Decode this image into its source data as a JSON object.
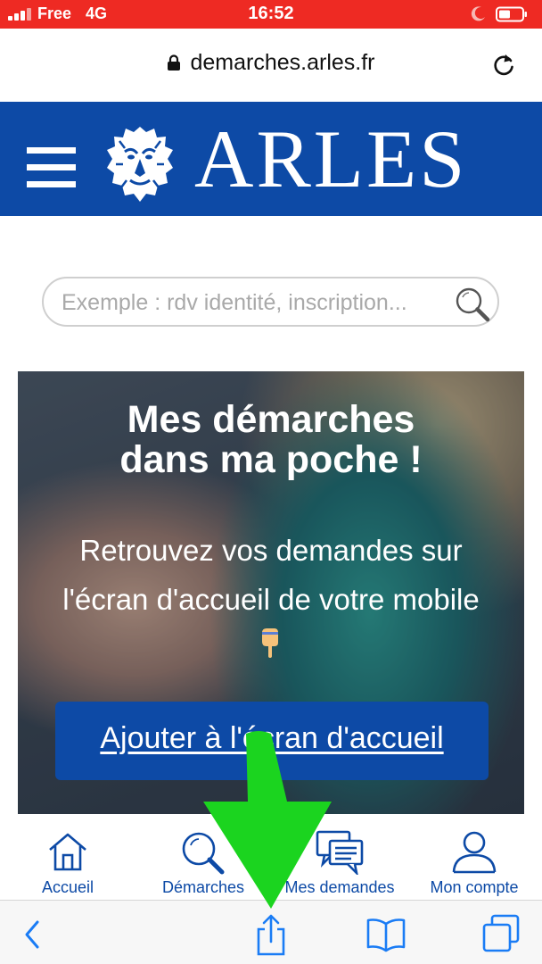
{
  "status_bar": {
    "carrier": "Free",
    "network": "4G",
    "time": "16:52"
  },
  "address_bar": {
    "url": "demarches.arles.fr"
  },
  "site_header": {
    "brand": "ARLES"
  },
  "search": {
    "placeholder": "Exemple : rdv identité, inscription..."
  },
  "promo": {
    "title_line1": "Mes démarches",
    "title_line2": "dans ma poche !",
    "subtitle_line1": "Retrouvez vos demandes sur",
    "subtitle_line2": "l'écran d'accueil de votre mobile",
    "cta_label": "Ajouter à l'écran d'accueil"
  },
  "site_nav": {
    "items": [
      {
        "label": "Accueil",
        "icon": "home-icon"
      },
      {
        "label": "Démarches",
        "icon": "search-icon"
      },
      {
        "label": "Mes demandes",
        "icon": "chat-icon"
      },
      {
        "label": "Mon compte",
        "icon": "user-icon"
      }
    ]
  },
  "browser_toolbar": {
    "icons": [
      "back-icon",
      "share-icon",
      "bookmarks-icon",
      "tabs-icon"
    ]
  },
  "colors": {
    "status_bar": "#ee2a23",
    "brand_blue": "#0d4aa6",
    "arrow_green": "#1bd41f",
    "ios_blue": "#1a7cf5"
  }
}
